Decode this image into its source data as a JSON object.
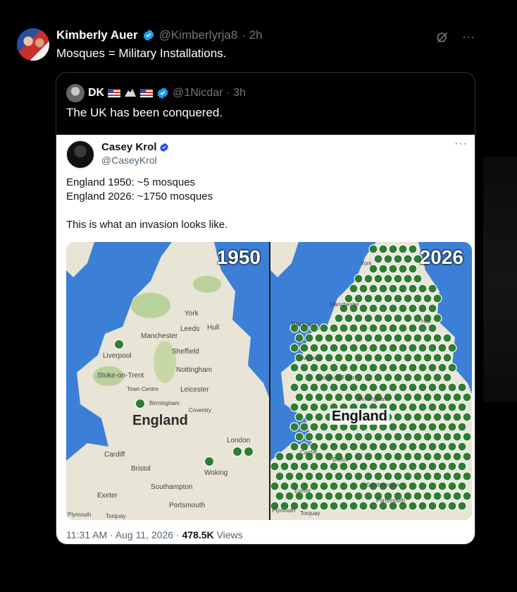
{
  "post": {
    "author_name": "Kimberly Auer",
    "handle": "@Kimberlyrja8",
    "time": "· 2h",
    "text": "Mosques = Military Installations.",
    "more": "···"
  },
  "quote": {
    "author_name": "DK",
    "handle": "@1Nicdar",
    "time": "· 3h",
    "text": "The UK has been conquered."
  },
  "embedded": {
    "author_name": "Casey Krol",
    "handle": "@CaseyKrol",
    "more": "···",
    "line1": "England 1950: ~5 mosques",
    "line2": "England 2026: ~1750 mosques",
    "line3": "This is what an invasion looks like.",
    "timestamp": "11:31 AM · Aug 11, 2026 · ",
    "views_count": "478.5K",
    "views_label": " Views"
  },
  "maps": {
    "left": {
      "year": "1950",
      "region": "England",
      "cities": [
        "York",
        "Leeds",
        "Hull",
        "Manchester",
        "Liverpool",
        "Sheffield",
        "Nottingham",
        "Stoke-on-Trent",
        "Town Centre",
        "Leicester",
        "Birmingham",
        "Coventry",
        "London",
        "Cardiff",
        "Bristol",
        "Woking",
        "Southampton",
        "Exeter",
        "Portsmouth",
        "Plymouth",
        "Torquay"
      ]
    },
    "right": {
      "year": "2026",
      "region": "England",
      "cities": [
        "York",
        "Manchester",
        "Blackpool",
        "Hull",
        "Liverpool",
        "Stoke-on-Trent",
        "Birmingham",
        "Cardiff",
        "Bristol",
        "Exeter",
        "Southampton",
        "Portsmouth",
        "Plymouth",
        "Torquay"
      ]
    }
  },
  "colors": {
    "background": "#000000",
    "text": "#e7e9ea",
    "muted": "#71767b",
    "verified": "#1d9bf0",
    "sea": "#3c7fd6",
    "land": "#e8e4d6",
    "mosque": "#2e7d32"
  }
}
